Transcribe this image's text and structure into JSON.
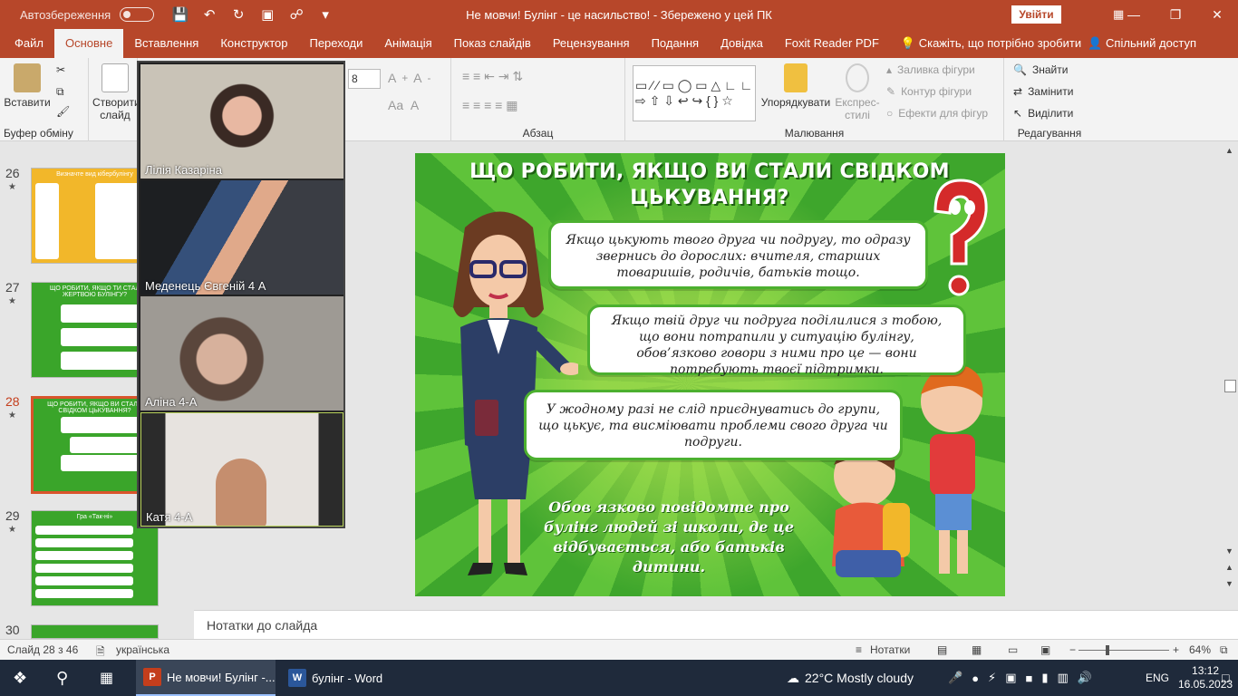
{
  "window": {
    "autosave_label": "Автозбереження",
    "autosave_state": "Вимк.",
    "title": "Не мовчи! Булінг - це насильство!  -  Збережено у цей ПК",
    "signin_label": "Увійти"
  },
  "tabs": [
    "Файл",
    "Основне",
    "Вставлення",
    "Конструктор",
    "Переходи",
    "Анімація",
    "Показ слайдів",
    "Рецензування",
    "Подання",
    "Довідка",
    "Foxit Reader PDF"
  ],
  "tell_me": "Скажіть, що потрібно зробити",
  "share_label": "Спільний доступ",
  "ribbon": {
    "paste_label": "Вставити",
    "clipboard_group": "Буфер обміну",
    "new_slide_label": "Створити слайд",
    "font_size": "8",
    "paragraph_group": "Абзац",
    "drawing_group": "Малювання",
    "arrange_label": "Упорядкувати",
    "quick_styles_label": "Експрес-стилі",
    "shape_fill": "Заливка фігури",
    "shape_outline": "Контур фігури",
    "shape_effects": "Ефекти для фігур",
    "find_label": "Знайти",
    "replace_label": "Замінити",
    "select_label": "Виділити",
    "editing_group": "Редагування"
  },
  "thumbnails": [
    {
      "num": "26",
      "title": "Визначте вид кібербулінгу"
    },
    {
      "num": "27",
      "title": "ЩО РОБИТИ, ЯКЩО ТИ СТАЛ ЖЕРТВОЮ БУЛІНГУ?"
    },
    {
      "num": "28",
      "title": "ЩО РОБИТИ, ЯКЩО ВИ СТАЛИ СВІДКОМ ЦЬКУВАННЯ?"
    },
    {
      "num": "29",
      "title": "Гра «Так-ні»"
    },
    {
      "num": "30",
      "title": ""
    }
  ],
  "video_participants": [
    "Лілія Казаріна",
    "Меденець Євгеній 4 А",
    "Аліна 4-А",
    "Катя  4-А"
  ],
  "slide": {
    "title_line1": "ЩО РОБИТИ, ЯКЩО ВИ СТАЛИ СВІДКОМ",
    "title_line2": "ЦЬКУВАННЯ?",
    "bubble1": "Якщо цькують твого друга чи подругу, то одразу звернись до дорослих: вчителя, старших товаришів, родичів, батьків тощо.",
    "bubble2": "Якщо твій друг чи подруга поділилися з тобою, що вони потрапили у ситуацію булінгу, обов’язково говори з ними про це — вони потребують твоєї підтримки.",
    "bubble3": "У жодному разі не слід приєднуватись до групи, що цькує, та висміювати проблеми свого друга чи подруги.",
    "bottom_text": "Обов язково повідомте про булінг людей зі школи, де це відбувається, або батьків дитини."
  },
  "notes_placeholder": "Нотатки до слайда",
  "status": {
    "slide_counter": "Слайд 28 з 46",
    "language": "українська",
    "notes_label": "Нотатки",
    "zoom": "64%",
    "zoom_fraction": 0.64
  },
  "taskbar": {
    "ppt_item": "Не мовчи! Булінг -...",
    "word_item": "булінг - Word",
    "weather": "22°C  Mostly cloudy",
    "lang": "ENG",
    "time": "13:12",
    "date": "16.05.2023"
  },
  "colors": {
    "accent": "#b7472a",
    "slide_green": "#3ea62c",
    "bubble_border": "#4cb02f",
    "selected_thumb": "#d9542b"
  }
}
